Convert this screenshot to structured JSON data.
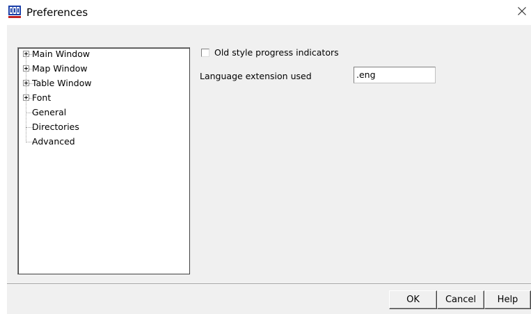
{
  "window": {
    "title": "Preferences",
    "icon": "mapinfo-app-icon",
    "close_glyph": "✕"
  },
  "tree": {
    "items": [
      {
        "label": "Main Window",
        "expandable": true
      },
      {
        "label": "Map Window",
        "expandable": true
      },
      {
        "label": "Table Window",
        "expandable": true
      },
      {
        "label": "Font",
        "expandable": true
      },
      {
        "label": "General",
        "expandable": false
      },
      {
        "label": "Directories",
        "expandable": false
      },
      {
        "label": "Advanced",
        "expandable": false
      }
    ]
  },
  "general": {
    "progress_checkbox_label": "Old style progress indicators",
    "progress_checked": false,
    "language_label": "Language extension used",
    "language_value": ".eng"
  },
  "buttons": {
    "ok": "OK",
    "cancel": "Cancel",
    "help": "Help"
  },
  "colors": {
    "dialog_bg": "#f0f0f0",
    "titlebar_bg": "#ffffff",
    "icon_blue": "#1a3fa8",
    "icon_red": "#c02020"
  }
}
